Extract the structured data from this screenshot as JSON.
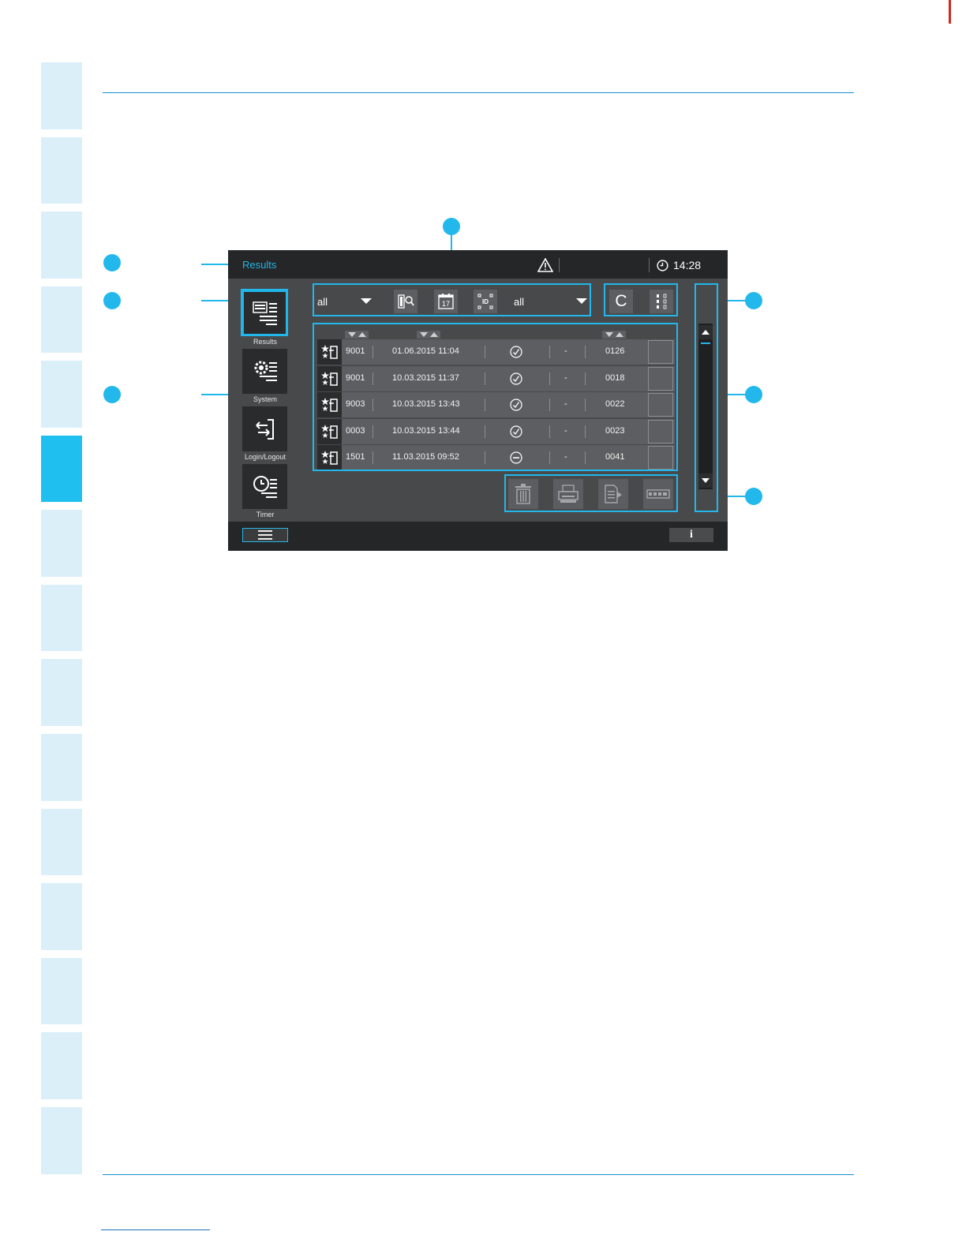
{
  "device": {
    "title": "Results",
    "time": "14:28"
  },
  "navigation": [
    {
      "label": "Results",
      "icon": "results-icon",
      "active": true
    },
    {
      "label": "System",
      "icon": "system-settings-icon",
      "active": false
    },
    {
      "label": "Login/Logout",
      "icon": "login-logout-icon",
      "active": false
    },
    {
      "label": "Timer",
      "icon": "timer-icon",
      "active": false
    }
  ],
  "filter": {
    "dropdown_1": "all",
    "dropdown_2": "all",
    "buttons": [
      "sample-search-icon",
      "calendar-icon",
      "id-scan-icon"
    ],
    "calendar_day": "17",
    "id_label": "ID"
  },
  "right_buttons": {
    "c_label": "C",
    "columns_icon": "column-settings-icon"
  },
  "results": {
    "rows": [
      {
        "id": "9001",
        "datetime": "01.06.2015 11:04",
        "status": "ok",
        "dash": "-",
        "number": "0126"
      },
      {
        "id": "9001",
        "datetime": "10.03.2015 11:37",
        "status": "ok",
        "dash": "-",
        "number": "0018"
      },
      {
        "id": "9003",
        "datetime": "10.03.2015 13:43",
        "status": "ok",
        "dash": "-",
        "number": "0022"
      },
      {
        "id": "0003",
        "datetime": "10.03.2015 13:44",
        "status": "ok",
        "dash": "-",
        "number": "0023"
      },
      {
        "id": "1501",
        "datetime": "11.03.2015 09:52",
        "status": "blocked",
        "dash": "-",
        "number": "0041"
      }
    ]
  },
  "actions": [
    "delete-icon",
    "print-icon",
    "export-icon",
    "lis-transfer-icon"
  ],
  "bottom": {
    "info_label": "i"
  },
  "colors": {
    "accent": "#22b8ec",
    "screen_bg": "#48494b",
    "bar_bg": "#252628",
    "side_tab": "#dbeff9",
    "side_tab_active": "#1fc0ef"
  }
}
